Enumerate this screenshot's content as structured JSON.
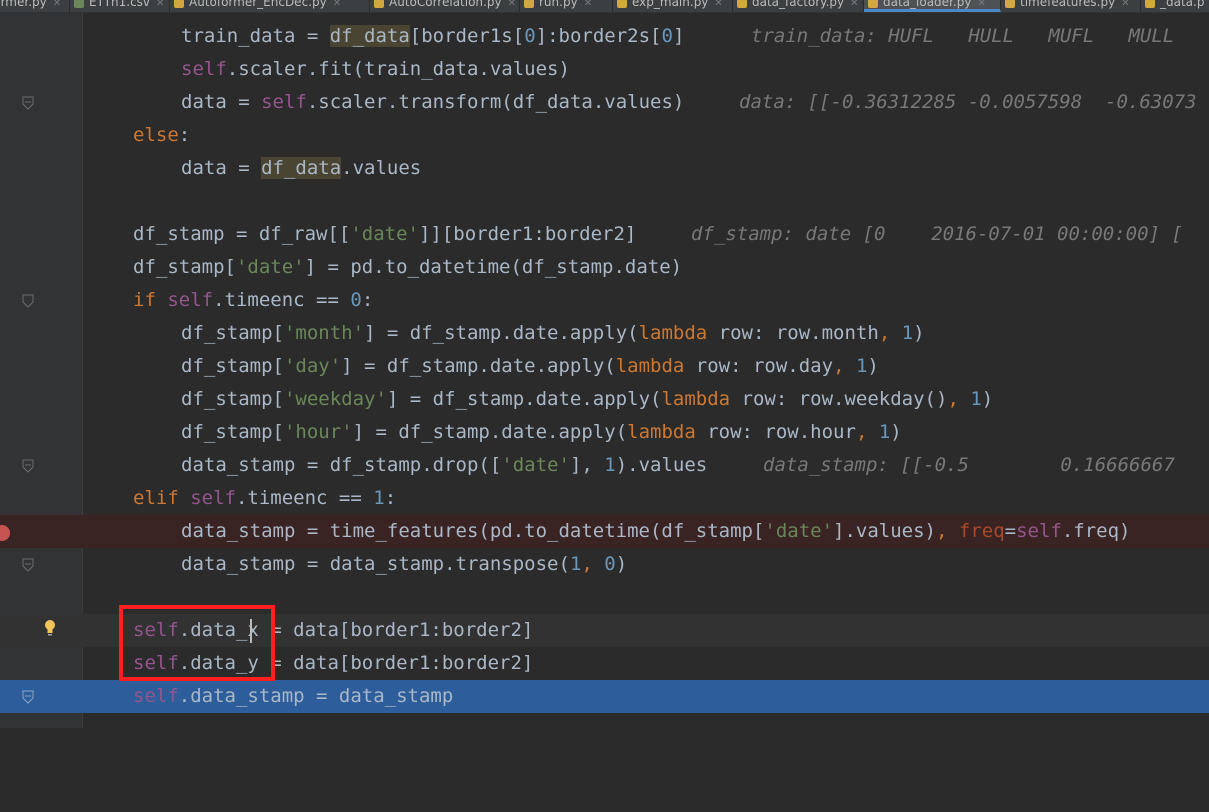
{
  "tabs": [
    {
      "label": "former.py",
      "color": "#4a88c7"
    },
    {
      "label": "ETTh1.csv",
      "color": "#6a8759"
    },
    {
      "label": "Autoformer_EncDec.py",
      "color": "#d1a73f"
    },
    {
      "label": "AutoCorrelation.py",
      "color": "#d1a73f"
    },
    {
      "label": "run.py",
      "color": "#d1a73f"
    },
    {
      "label": "exp_main.py",
      "color": "#d1a73f"
    },
    {
      "label": "data_factory.py",
      "color": "#d1a73f"
    },
    {
      "label": "data_loader.py",
      "color": "#d1a73f",
      "active": true
    },
    {
      "label": "timefeatures.py",
      "color": "#d1a73f"
    },
    {
      "label": "_data.p",
      "color": "#d1a73f"
    }
  ],
  "code": {
    "l1_a": "train_data = ",
    "l1_b": "df_data",
    "l1_c": "[border1s[",
    "l1_d": "0",
    "l1_e": "]:border2s[",
    "l1_f": "0",
    "l1_g": "]",
    "l1_hint": "train_data: HUFL   HULL   MUFL   MULL",
    "l2_self": "self",
    "l2_rest": ".scaler.fit(train_data.values)",
    "l3_a": "data = ",
    "l3_self": "self",
    "l3_b": ".scaler.transform(df_data.values)",
    "l3_hint": "data: [[-0.36312285 -0.0057598  -0.63073",
    "l4_kw": "else",
    "l4_rest": ":",
    "l5_a": "data = ",
    "l5_b": "df_data",
    "l5_c": ".values",
    "l7_a": "df_stamp = df_raw[[",
    "l7_str": "'date'",
    "l7_b": "]][border1:border2]",
    "l7_hint": "df_stamp: date [0    2016-07-01 00:00:00] [",
    "l8_a": "df_stamp[",
    "l8_str": "'date'",
    "l8_b": "] = pd.to_datetime(df_stamp.date)",
    "l9_kw": "if ",
    "l9_self": "self",
    "l9_a": ".timeenc == ",
    "l9_num": "0",
    "l9_b": ":",
    "l10_a": "df_stamp[",
    "l10_str": "'month'",
    "l10_b": "] = df_stamp.date.apply(",
    "l10_kw": "lambda",
    "l10_c": " row: row.month",
    "l10_comma": ", ",
    "l10_num": "1",
    "l10_d": ")",
    "l11_a": "df_stamp[",
    "l11_str": "'day'",
    "l11_b": "] = df_stamp.date.apply(",
    "l11_kw": "lambda",
    "l11_c": " row: row.day",
    "l11_comma": ", ",
    "l11_num": "1",
    "l11_d": ")",
    "l12_a": "df_stamp[",
    "l12_str": "'weekday'",
    "l12_b": "] = df_stamp.date.apply(",
    "l12_kw": "lambda",
    "l12_c": " row: row.weekday()",
    "l12_comma": ", ",
    "l12_num": "1",
    "l12_d": ")",
    "l13_a": "df_stamp[",
    "l13_str": "'hour'",
    "l13_b": "] = df_stamp.date.apply(",
    "l13_kw": "lambda",
    "l13_c": " row: row.hour",
    "l13_comma": ", ",
    "l13_num": "1",
    "l13_d": ")",
    "l14_a": "data_stamp = df_stamp.drop([",
    "l14_str": "'date'",
    "l14_comma": "], ",
    "l14_num": "1",
    "l14_b": ").values",
    "l14_hint": "data_stamp: [[-0.5        0.16666667",
    "l15_kw": "elif ",
    "l15_self": "self",
    "l15_a": ".timeenc == ",
    "l15_num": "1",
    "l15_b": ":",
    "l16_a": "data_stamp = time_features(pd.to_datetime(df_stamp[",
    "l16_str": "'date'",
    "l16_b": "].values)",
    "l16_comma": ", ",
    "l16_param": "freq",
    "l16_eq": "=",
    "l16_self": "self",
    "l16_c": ".freq)",
    "l17_a": "data_stamp = data_stamp.transpose(",
    "l17_num1": "1",
    "l17_comma": ", ",
    "l17_num2": "0",
    "l17_b": ")",
    "l19_self": "self",
    "l19_a": ".data_x = data[border1:border2]",
    "l20_self": "self",
    "l20_a": ".data_y = data[border1:border2]",
    "l21_self": "self",
    "l21_a": ".data_stamp = data_stamp"
  }
}
